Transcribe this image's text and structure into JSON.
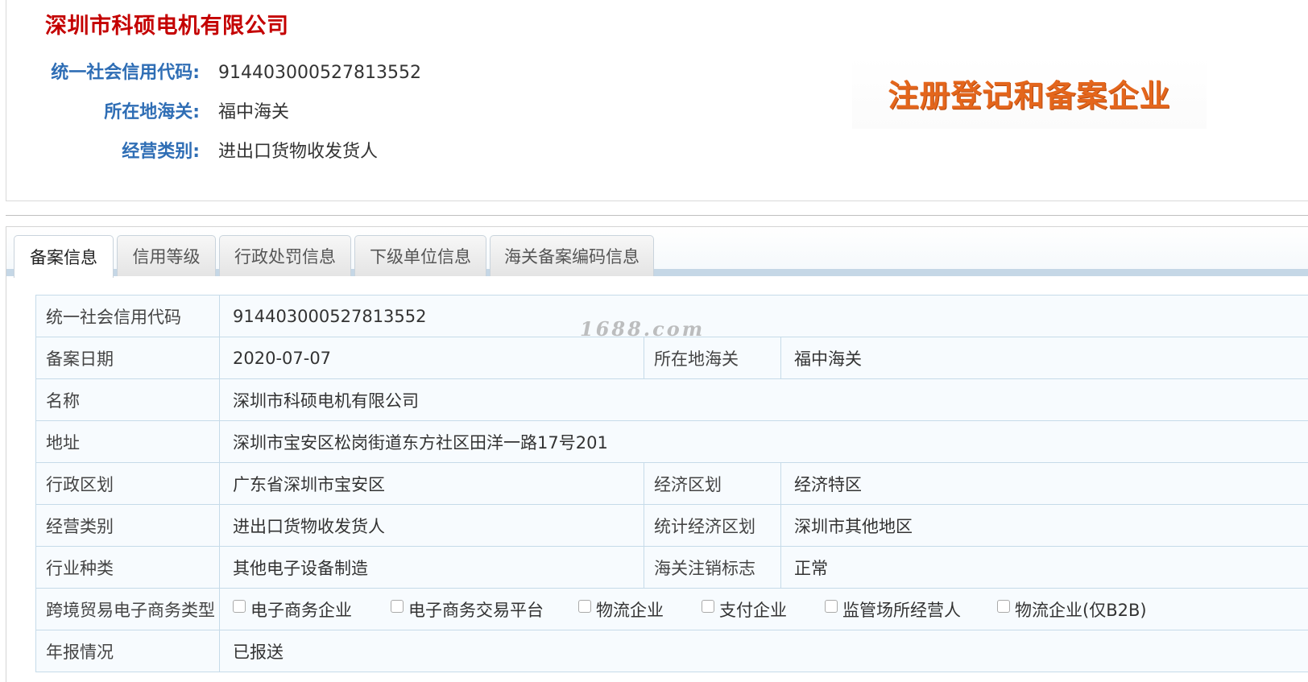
{
  "header": {
    "company_name": "深圳市科硕电机有限公司",
    "credit_code_label": "统一社会信用代码:",
    "credit_code_value": "914403000527813552",
    "customs_label": "所在地海关:",
    "customs_value": "福中海关",
    "business_type_label": "经营类别:",
    "business_type_value": "进出口货物收发货人",
    "badge_text": "注册登记和备案企业"
  },
  "tabs": [
    {
      "label": "备案信息",
      "active": true
    },
    {
      "label": "信用等级",
      "active": false
    },
    {
      "label": "行政处罚信息",
      "active": false
    },
    {
      "label": "下级单位信息",
      "active": false
    },
    {
      "label": "海关备案编码信息",
      "active": false
    }
  ],
  "table": {
    "credit_code": {
      "label": "统一社会信用代码",
      "value": "914403000527813552"
    },
    "record_date": {
      "label": "备案日期",
      "value": "2020-07-07"
    },
    "customs": {
      "label": "所在地海关",
      "value": "福中海关"
    },
    "name": {
      "label": "名称",
      "value": "深圳市科硕电机有限公司"
    },
    "address": {
      "label": "地址",
      "value": "深圳市宝安区松岗街道东方社区田洋一路17号201"
    },
    "admin_region": {
      "label": "行政区划",
      "value": "广东省深圳市宝安区"
    },
    "economic_region": {
      "label": "经济区划",
      "value": "经济特区"
    },
    "business_type": {
      "label": "经营类别",
      "value": "进出口货物收发货人"
    },
    "stat_region": {
      "label": "统计经济区划",
      "value": "深圳市其他地区"
    },
    "industry": {
      "label": "行业种类",
      "value": "其他电子设备制造"
    },
    "cancel_flag": {
      "label": "海关注销标志",
      "value": "正常"
    },
    "ecommerce": {
      "label": "跨境贸易电子商务类型",
      "options": [
        {
          "label": "电子商务企业",
          "checked": false
        },
        {
          "label": "电子商务交易平台",
          "checked": false
        },
        {
          "label": "物流企业",
          "checked": false
        },
        {
          "label": "支付企业",
          "checked": false
        },
        {
          "label": "监管场所经营人",
          "checked": false
        },
        {
          "label": "物流企业(仅B2B)",
          "checked": false
        }
      ]
    },
    "annual_report": {
      "label": "年报情况",
      "value": "已报送"
    }
  },
  "watermark": "1688.com",
  "colors": {
    "title_red": "#c40000",
    "label_blue": "#2f6eb5",
    "badge_orange": "#e4661c",
    "table_border": "#c6dbe9"
  }
}
